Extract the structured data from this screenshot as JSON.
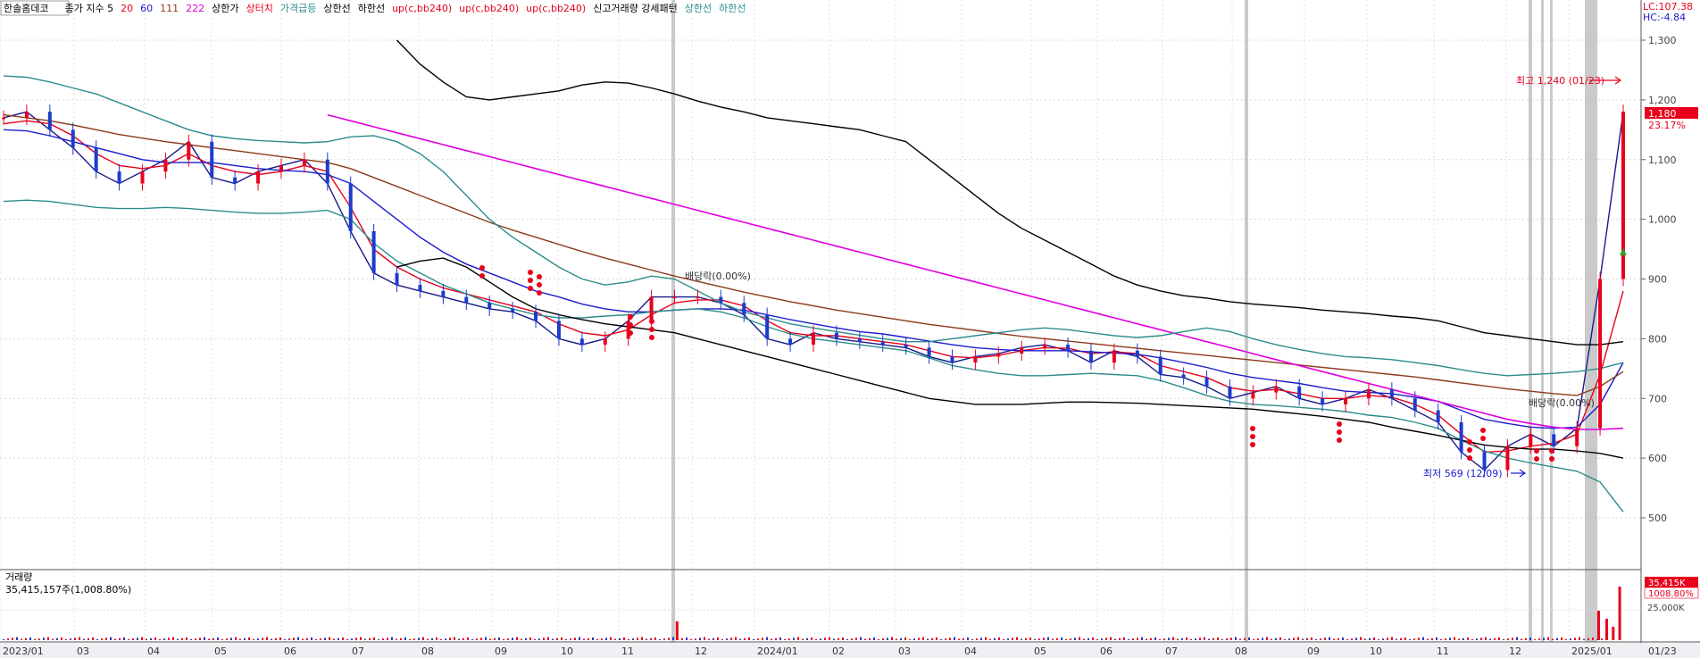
{
  "chart_data": {
    "type": "line",
    "title": "한솔홈데코",
    "legend_items": [
      {
        "text": "한솔홈데코",
        "color": "#000000"
      },
      {
        "text": "종가 지수 5",
        "color": "#000000"
      },
      {
        "text": "20",
        "color": "#e8001c"
      },
      {
        "text": "60",
        "color": "#1c1ccc"
      },
      {
        "text": "111",
        "color": "#8b3a1a"
      },
      {
        "text": "222",
        "color": "#e000e0"
      },
      {
        "text": "상한가",
        "color": "#000000"
      },
      {
        "text": "상터치",
        "color": "#e8001c"
      },
      {
        "text": "가격급등",
        "color": "#2c8c8c"
      },
      {
        "text": "상한선",
        "color": "#000000"
      },
      {
        "text": "하한선",
        "color": "#000000"
      },
      {
        "text": "up(c,bb240)",
        "color": "#e8001c"
      },
      {
        "text": "up(c,bb240)",
        "color": "#e8001c"
      },
      {
        "text": "up(c,bb240)",
        "color": "#e8001c"
      },
      {
        "text": "신고거래량 강세패턴",
        "color": "#000000"
      },
      {
        "text": "상한선",
        "color": "#2c8c8c"
      },
      {
        "text": "하한선",
        "color": "#2c8c8c"
      }
    ],
    "top_right": {
      "lc": "LC:107.38",
      "hc": "HC:-4.84"
    },
    "y_ticks": [
      {
        "v": 1300,
        "label": "1,300"
      },
      {
        "v": 1200,
        "label": "1,200"
      },
      {
        "v": 1100,
        "label": "1,100"
      },
      {
        "v": 1000,
        "label": "1,000"
      },
      {
        "v": 900,
        "label": "900"
      },
      {
        "v": 800,
        "label": "800"
      },
      {
        "v": 700,
        "label": "700"
      },
      {
        "v": 600,
        "label": "600"
      },
      {
        "v": 500,
        "label": "500"
      }
    ],
    "ylim": [
      400,
      1380
    ],
    "x_labels": [
      "2023/01",
      "03",
      "04",
      "05",
      "06",
      "07",
      "08",
      "09",
      "10",
      "11",
      "12",
      "2024/01",
      "02",
      "03",
      "04",
      "05",
      "06",
      "07",
      "08",
      "09",
      "10",
      "11",
      "12",
      "2025/01",
      "01/23"
    ],
    "price_now": {
      "value": "1,180",
      "change": "23.17%"
    },
    "annotations": {
      "high": "최고 1,240 (01/23)",
      "low": "최저 569 (12/09)",
      "dividend_1": "배당락(0.00%)",
      "dividend_2": "배당락(0.00%)"
    },
    "series": [
      {
        "name": "종가",
        "color": "#1a1a8c",
        "values": [
          1170,
          1180,
          1150,
          1120,
          1080,
          1060,
          1080,
          1100,
          1130,
          1070,
          1060,
          1080,
          1090,
          1100,
          1060,
          980,
          910,
          890,
          880,
          870,
          860,
          850,
          845,
          830,
          800,
          790,
          800,
          830,
          870,
          870,
          870,
          860,
          840,
          800,
          790,
          810,
          800,
          795,
          790,
          785,
          770,
          760,
          770,
          775,
          785,
          790,
          780,
          760,
          780,
          770,
          740,
          735,
          720,
          700,
          710,
          720,
          700,
          690,
          700,
          715,
          700,
          680,
          660,
          610,
          580,
          620,
          640,
          620,
          650,
          900,
          1180
        ]
      },
      {
        "name": "20",
        "color": "#e8001c",
        "values": [
          1160,
          1165,
          1160,
          1140,
          1110,
          1090,
          1085,
          1090,
          1110,
          1090,
          1080,
          1075,
          1080,
          1090,
          1080,
          1020,
          950,
          920,
          900,
          885,
          875,
          865,
          855,
          845,
          825,
          810,
          805,
          815,
          840,
          860,
          865,
          865,
          855,
          830,
          810,
          805,
          805,
          800,
          795,
          790,
          780,
          770,
          768,
          772,
          780,
          785,
          784,
          775,
          778,
          775,
          755,
          745,
          735,
          718,
          712,
          715,
          708,
          700,
          700,
          705,
          702,
          690,
          672,
          640,
          610,
          612,
          620,
          625,
          640,
          740,
          880
        ]
      },
      {
        "name": "60",
        "color": "#1c1ccc",
        "values": [
          1150,
          1148,
          1140,
          1130,
          1120,
          1110,
          1100,
          1095,
          1095,
          1095,
          1090,
          1085,
          1082,
          1080,
          1075,
          1060,
          1030,
          1000,
          970,
          945,
          925,
          910,
          895,
          880,
          870,
          858,
          850,
          845,
          845,
          848,
          850,
          850,
          848,
          840,
          832,
          825,
          818,
          812,
          808,
          802,
          796,
          790,
          785,
          782,
          780,
          780,
          780,
          778,
          776,
          774,
          768,
          760,
          752,
          742,
          735,
          730,
          725,
          718,
          712,
          710,
          708,
          702,
          695,
          680,
          665,
          658,
          652,
          650,
          652,
          690,
          760
        ]
      },
      {
        "name": "111",
        "color": "#8b3a1a",
        "values": [
          1175,
          1170,
          1165,
          1158,
          1150,
          1142,
          1136,
          1130,
          1125,
          1120,
          1115,
          1110,
          1105,
          1100,
          1095,
          1085,
          1070,
          1055,
          1040,
          1025,
          1010,
          995,
          982,
          970,
          958,
          946,
          935,
          925,
          915,
          905,
          896,
          887,
          878,
          870,
          862,
          855,
          848,
          842,
          836,
          830,
          824,
          819,
          814,
          809,
          804,
          800,
          796,
          792,
          788,
          784,
          780,
          776,
          772,
          768,
          764,
          760,
          756,
          752,
          748,
          744,
          740,
          736,
          731,
          726,
          721,
          716,
          712,
          708,
          705,
          720,
          745
        ]
      },
      {
        "name": "222",
        "color": "#e000e0",
        "values": [
          null,
          null,
          null,
          null,
          null,
          null,
          null,
          null,
          null,
          null,
          null,
          null,
          null,
          null,
          1175,
          1165,
          1155,
          1145,
          1135,
          1125,
          1115,
          1105,
          1095,
          1085,
          1075,
          1065,
          1055,
          1045,
          1035,
          1025,
          1015,
          1005,
          995,
          985,
          975,
          965,
          955,
          945,
          935,
          925,
          915,
          905,
          895,
          885,
          875,
          865,
          855,
          845,
          835,
          825,
          815,
          805,
          795,
          785,
          775,
          765,
          755,
          745,
          735,
          725,
          715,
          705,
          695,
          685,
          675,
          665,
          658,
          652,
          648,
          648,
          650
        ]
      },
      {
        "name": "상한선",
        "color": "#2c8c8c",
        "values": [
          1240,
          1238,
          1230,
          1220,
          1210,
          1195,
          1180,
          1165,
          1150,
          1140,
          1135,
          1132,
          1130,
          1128,
          1130,
          1138,
          1140,
          1130,
          1110,
          1080,
          1040,
          1000,
          970,
          945,
          920,
          900,
          890,
          895,
          905,
          900,
          880,
          860,
          845,
          835,
          825,
          818,
          812,
          806,
          800,
          795,
          795,
          800,
          805,
          810,
          815,
          818,
          815,
          810,
          805,
          802,
          805,
          812,
          818,
          812,
          800,
          790,
          782,
          775,
          770,
          768,
          765,
          760,
          755,
          748,
          742,
          738,
          740,
          742,
          745,
          750,
          760
        ]
      },
      {
        "name": "하한선",
        "color": "#2c8c8c",
        "values": [
          1030,
          1032,
          1030,
          1025,
          1020,
          1018,
          1018,
          1020,
          1018,
          1015,
          1012,
          1010,
          1010,
          1012,
          1015,
          1000,
          960,
          930,
          910,
          890,
          875,
          860,
          850,
          840,
          835,
          835,
          838,
          840,
          845,
          848,
          850,
          845,
          835,
          820,
          808,
          800,
          795,
          790,
          785,
          780,
          768,
          755,
          748,
          742,
          738,
          738,
          740,
          742,
          740,
          738,
          730,
          718,
          705,
          695,
          690,
          688,
          685,
          682,
          678,
          672,
          668,
          660,
          650,
          630,
          612,
          600,
          592,
          585,
          578,
          560,
          510
        ]
      },
      {
        "name": "상한선(bb240)",
        "color": "#000000",
        "values": [
          null,
          null,
          null,
          null,
          null,
          null,
          null,
          null,
          null,
          null,
          null,
          null,
          null,
          null,
          null,
          null,
          null,
          1300,
          1260,
          1230,
          1205,
          1200,
          1205,
          1210,
          1215,
          1225,
          1230,
          1228,
          1220,
          1210,
          1198,
          1188,
          1180,
          1170,
          1165,
          1160,
          1155,
          1150,
          1140,
          1130,
          1100,
          1070,
          1040,
          1010,
          985,
          965,
          945,
          925,
          905,
          890,
          880,
          872,
          868,
          862,
          858,
          855,
          852,
          848,
          845,
          842,
          838,
          835,
          830,
          820,
          810,
          805,
          800,
          795,
          790,
          790,
          795
        ]
      },
      {
        "name": "하한선(bb240)",
        "color": "#000000",
        "values": [
          null,
          null,
          null,
          null,
          null,
          null,
          null,
          null,
          null,
          null,
          null,
          null,
          null,
          null,
          null,
          null,
          null,
          920,
          930,
          935,
          920,
          895,
          870,
          850,
          840,
          832,
          825,
          820,
          815,
          810,
          800,
          790,
          780,
          770,
          760,
          750,
          740,
          730,
          720,
          710,
          700,
          695,
          690,
          690,
          690,
          692,
          694,
          694,
          693,
          692,
          690,
          688,
          686,
          684,
          682,
          678,
          674,
          670,
          665,
          660,
          652,
          645,
          638,
          630,
          622,
          618,
          615,
          615,
          612,
          608,
          600
        ]
      }
    ],
    "volume": {
      "label": "거래량",
      "value_text": "35,415,157주(1,008.80%)",
      "right_label": "35,415K",
      "right_pct": "1008.80%",
      "axis_label": "25,000K",
      "spikes": [
        {
          "pos": 0.415,
          "value": 0.35
        },
        {
          "pos": 0.984,
          "value": 0.55
        },
        {
          "pos": 0.989,
          "value": 0.4
        },
        {
          "pos": 0.993,
          "value": 0.25
        },
        {
          "pos": 0.997,
          "value": 1.0
        }
      ]
    }
  }
}
